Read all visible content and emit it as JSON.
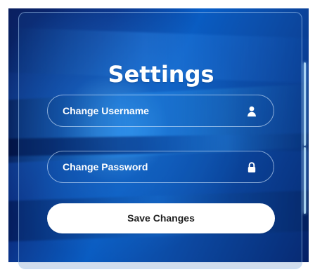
{
  "settings": {
    "title": "Settings",
    "fields": [
      {
        "label": "Change Username",
        "icon": "user-icon"
      },
      {
        "label": "Change Password",
        "icon": "lock-icon"
      }
    ],
    "save_button": {
      "label": "Save Changes"
    }
  },
  "theme": {
    "background_colors": [
      "#0a1d5b",
      "#075ec8",
      "#041c60"
    ],
    "text_color": "#ffffff",
    "button_background": "#ffffff",
    "button_text": "#1f1f1f"
  }
}
